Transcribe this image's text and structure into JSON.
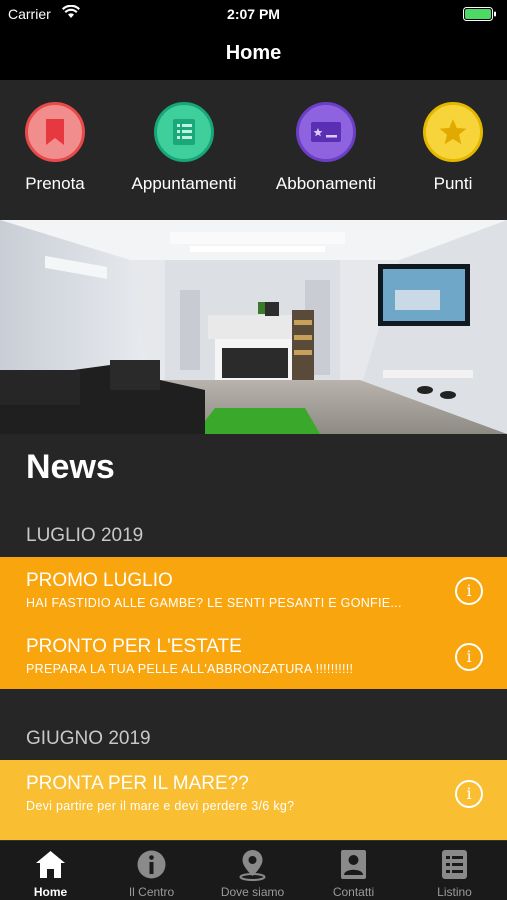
{
  "status_bar": {
    "carrier": "Carrier",
    "time": "2:07 PM"
  },
  "nav": {
    "title": "Home"
  },
  "quick_actions": [
    {
      "label": "Prenota",
      "icon": "bookmark-icon",
      "fill": "#f28d8d",
      "border": "#e84a4a"
    },
    {
      "label": "Appuntamenti",
      "icon": "list-icon",
      "fill": "#3fcf9c",
      "border": "#17a67a"
    },
    {
      "label": "Abbonamenti",
      "icon": "ticket-icon",
      "fill": "#8f63e0",
      "border": "#6a3fc4"
    },
    {
      "label": "Punti",
      "icon": "star-icon",
      "fill": "#f7d53a",
      "border": "#e5b800"
    }
  ],
  "news": {
    "title": "News",
    "sections": [
      {
        "month": "LUGLIO 2019",
        "color": "#f9a50d",
        "items": [
          {
            "title": "PROMO LUGLIO",
            "subtitle": "HAI FASTIDIO ALLE GAMBE? LE SENTI PESANTI E GONFIE..."
          },
          {
            "title": "PRONTO PER L'ESTATE",
            "subtitle": "PREPARA LA TUA PELLE ALL'ABBRONZATURA !!!!!!!!!!"
          }
        ]
      },
      {
        "month": "GIUGNO 2019",
        "color": "#f9be32",
        "items": [
          {
            "title": "PRONTA PER IL MARE??",
            "subtitle": "Devi partire per il mare e devi perdere 3/6 kg?"
          }
        ]
      }
    ]
  },
  "tabs": [
    {
      "label": "Home",
      "icon": "home-icon",
      "active": true
    },
    {
      "label": "Il Centro",
      "icon": "info-icon",
      "active": false
    },
    {
      "label": "Dove siamo",
      "icon": "map-pin-icon",
      "active": false
    },
    {
      "label": "Contatti",
      "icon": "contact-icon",
      "active": false
    },
    {
      "label": "Listino",
      "icon": "price-list-icon",
      "active": false
    }
  ]
}
